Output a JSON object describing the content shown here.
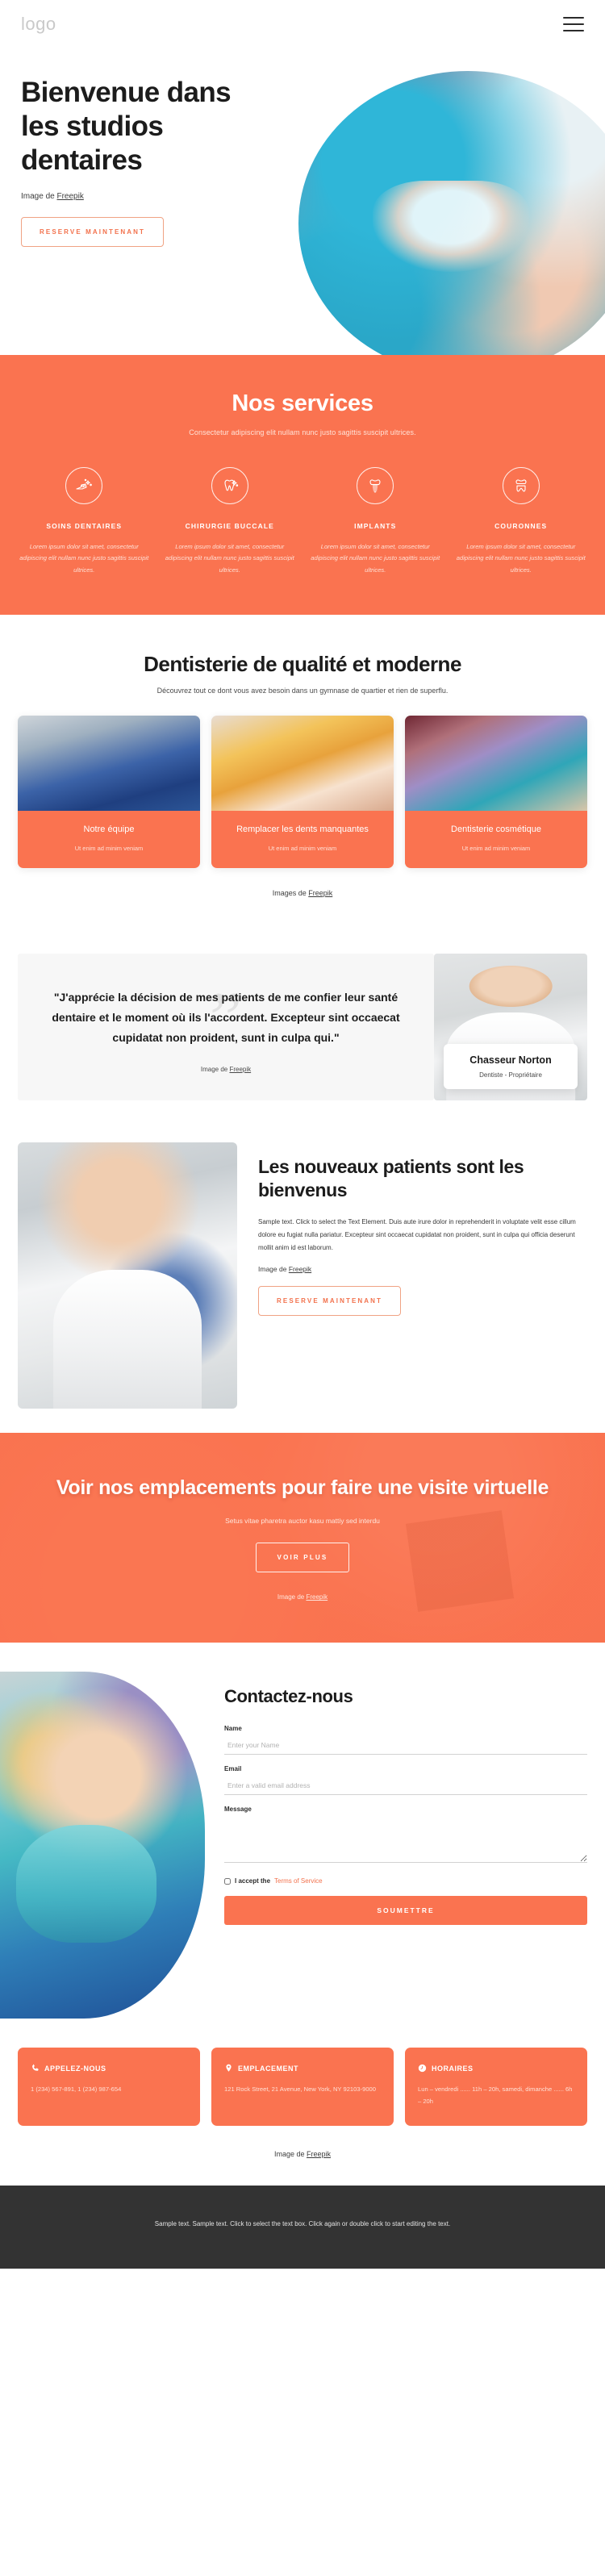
{
  "header": {
    "logo": "logo",
    "menu_icon": "hamburger-menu-icon"
  },
  "hero": {
    "title": "Bienvenue dans les studios dentaires",
    "credit_prefix": "Image de ",
    "credit_link": "Freepik",
    "cta": "RESERVE MAINTENANT"
  },
  "services": {
    "title": "Nos services",
    "subtitle": "Consectetur adipiscing elit nullam nunc justo sagittis suscipit ultrices.",
    "items": [
      {
        "icon": "toothbrush-icon",
        "title": "SOINS DENTAIRES",
        "text": "Lorem ipsum dolor sit amet, consectetur adipiscing elit nullam nunc justo sagittis suscipit ultrices."
      },
      {
        "icon": "sparkling-tooth-icon",
        "title": "CHIRURGIE BUCCALE",
        "text": "Lorem ipsum dolor sit amet, consectetur adipiscing elit nullam nunc justo sagittis suscipit ultrices."
      },
      {
        "icon": "dental-implant-icon",
        "title": "IMPLANTS",
        "text": "Lorem ipsum dolor sit amet, consectetur adipiscing elit nullam nunc justo sagittis suscipit ultrices."
      },
      {
        "icon": "dental-crown-icon",
        "title": "COURONNES",
        "text": "Lorem ipsum dolor sit amet, consectetur adipiscing elit nullam nunc justo sagittis suscipit ultrices."
      }
    ]
  },
  "quality": {
    "title": "Dentisterie de qualité et moderne",
    "subtitle": "Découvrez tout ce dont vous avez besoin dans un gymnase de quartier et rien de superflu.",
    "cards": [
      {
        "title": "Notre équipe",
        "text": "Ut enim ad minim veniam"
      },
      {
        "title": "Remplacer les dents manquantes",
        "text": "Ut enim ad minim veniam"
      },
      {
        "title": "Dentisterie cosmétique",
        "text": "Ut enim ad minim veniam"
      }
    ],
    "credit_prefix": "Images de ",
    "credit_link": "Freepik"
  },
  "testimonial": {
    "quote": "\"J'apprécie la décision de mes patients de me confier leur santé dentaire et le moment où ils l'accordent. Excepteur sint occaecat cupidatat non proident, sunt in culpa qui.\"",
    "credit_prefix": "Image de ",
    "credit_link": "Freepik",
    "author_name": "Chasseur Norton",
    "author_role": "Dentiste - Propriétaire"
  },
  "patients": {
    "title": "Les nouveaux patients sont les bienvenus",
    "body": "Sample text. Click to select the Text Element. Duis aute irure dolor in reprehenderit in voluptate velit esse cillum dolore eu fugiat nulla pariatur. Excepteur sint occaecat cupidatat non proident, sunt in culpa qui officia deserunt mollit anim id est laborum.",
    "credit_prefix": "Image de ",
    "credit_link": "Freepik",
    "cta": "RESERVE MAINTENANT"
  },
  "visit": {
    "title": "Voir nos emplacements pour faire une visite virtuelle",
    "subtitle": "Setus vitae pharetra auctor kasu mattiy sed interdu",
    "cta": "VOIR PLUS",
    "credit_prefix": "Image de ",
    "credit_link": "Freepik"
  },
  "contact": {
    "title": "Contactez-nous",
    "name_label": "Name",
    "name_placeholder": "Enter your Name",
    "email_label": "Email",
    "email_placeholder": "Enter a valid email address",
    "message_label": "Message",
    "message_placeholder": "",
    "consent_text": "I accept the ",
    "consent_link": "Terms of Service",
    "submit": "SOUMETTRE"
  },
  "info_cards": [
    {
      "icon": "phone-icon",
      "title": "APPELEZ-NOUS",
      "text": "1 (234) 567-891, 1 (234) 987-654"
    },
    {
      "icon": "map-pin-icon",
      "title": "EMPLACEMENT",
      "text": "121 Rock Street, 21 Avenue, New York, NY 92103-9000"
    },
    {
      "icon": "clock-icon",
      "title": "HORAIRES",
      "text": "Lun – vendredi ...... 11h – 20h, samedi, dimanche  ...... 6h – 20h"
    }
  ],
  "bottom_credit": {
    "prefix": "Image de ",
    "link": "Freepik"
  },
  "footer": {
    "text": "Sample text. Sample text. Click to select the text box. Click again or double click to start editing the text."
  },
  "colors": {
    "accent": "#fa7350",
    "accent_text": "#f2714c",
    "footer_bg": "#333333",
    "muted_bg": "#f7f7f7"
  }
}
